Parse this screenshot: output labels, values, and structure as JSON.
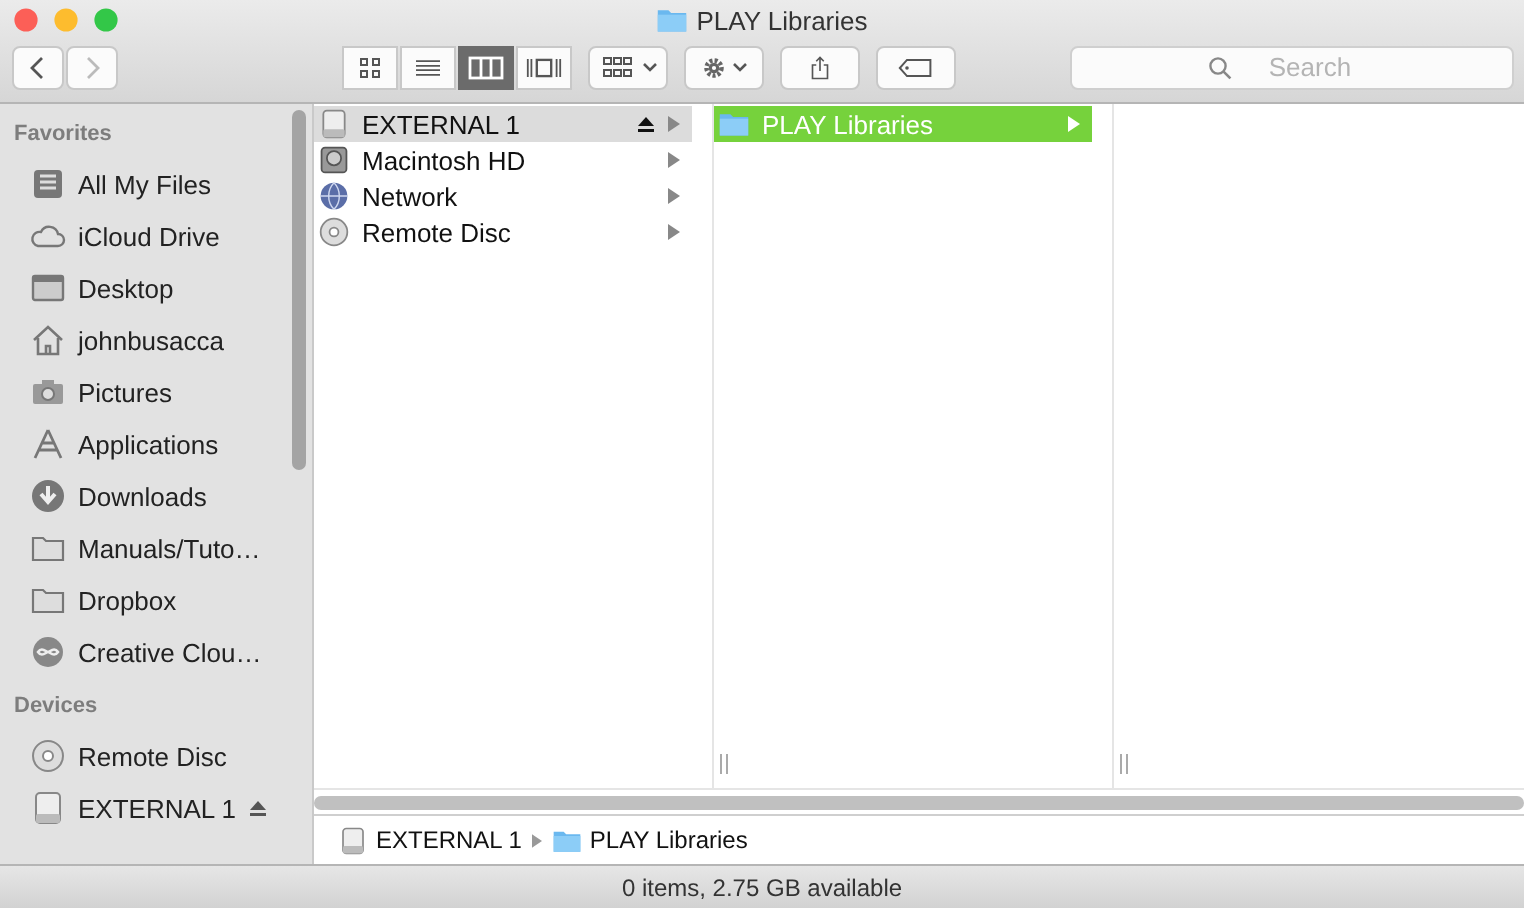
{
  "window": {
    "title": "PLAY Libraries"
  },
  "toolbar": {
    "view_modes": [
      {
        "kind": "icons",
        "selected": false
      },
      {
        "kind": "list",
        "selected": false
      },
      {
        "kind": "columns",
        "selected": true
      },
      {
        "kind": "coverflow",
        "selected": false
      }
    ],
    "search": {
      "placeholder": "Search"
    }
  },
  "sidebar": {
    "sections": [
      {
        "heading": "Favorites",
        "items": [
          {
            "label": "All My Files",
            "kind": "files"
          },
          {
            "label": "iCloud Drive",
            "kind": "cloud"
          },
          {
            "label": "Desktop",
            "kind": "desktop"
          },
          {
            "label": "johnbusacca",
            "kind": "home"
          },
          {
            "label": "Pictures",
            "kind": "camera"
          },
          {
            "label": "Applications",
            "kind": "apps"
          },
          {
            "label": "Downloads",
            "kind": "download"
          },
          {
            "label": "Manuals/Tuto…",
            "kind": "folder"
          },
          {
            "label": "Dropbox",
            "kind": "folder"
          },
          {
            "label": "Creative Clou…",
            "kind": "creative"
          }
        ]
      },
      {
        "heading": "Devices",
        "items": [
          {
            "label": "Remote Disc",
            "kind": "disc"
          },
          {
            "label": "EXTERNAL 1",
            "kind": "drive",
            "eject": true
          }
        ]
      }
    ]
  },
  "columns": [
    {
      "items": [
        {
          "label": "EXTERNAL 1",
          "kind": "drive",
          "selected": true,
          "eject": true
        },
        {
          "label": "Macintosh HD",
          "kind": "hd",
          "selected": false
        },
        {
          "label": "Network",
          "kind": "globe",
          "selected": false
        },
        {
          "label": "Remote Disc",
          "kind": "disc",
          "selected": false
        }
      ]
    },
    {
      "items": [
        {
          "label": "PLAY Libraries",
          "kind": "bluefolder",
          "selected": true,
          "color": "#76d23c"
        }
      ]
    }
  ],
  "path_bar": [
    {
      "label": "EXTERNAL 1",
      "kind": "drive"
    },
    {
      "label": "PLAY Libraries",
      "kind": "bluefolder"
    }
  ],
  "status_bar": "0 items, 2.75 GB available"
}
